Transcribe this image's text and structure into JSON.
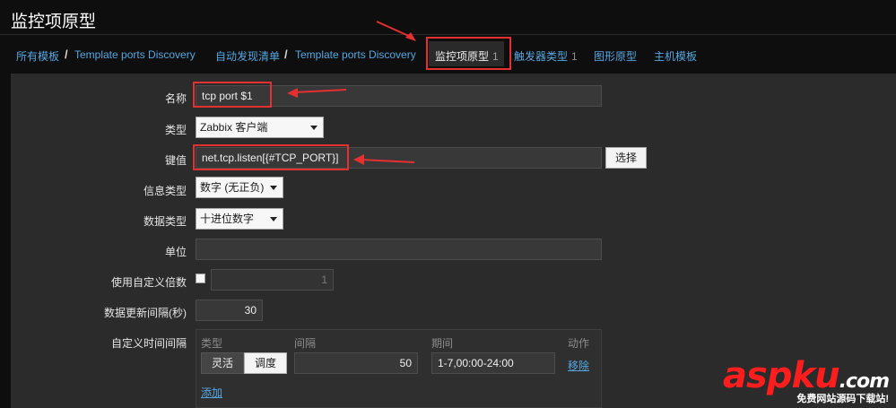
{
  "page": {
    "title": "监控项原型"
  },
  "breadcrumb": {
    "all_templates": "所有模板",
    "template1": "Template ports Discovery",
    "discovery_list": "自动发现清单",
    "template2": "Template ports Discovery",
    "separator": "/"
  },
  "tabs": [
    {
      "label": "监控项原型",
      "count": "1"
    },
    {
      "label": "触发器类型",
      "count": "1"
    },
    {
      "label": "图形原型",
      "count": ""
    },
    {
      "label": "主机模板",
      "count": ""
    }
  ],
  "form": {
    "name": {
      "label": "名称",
      "value": "tcp port $1"
    },
    "type": {
      "label": "类型",
      "value": "Zabbix 客户端"
    },
    "key": {
      "label": "键值",
      "value": "net.tcp.listen[{#TCP_PORT}]",
      "select_button": "选择"
    },
    "info_type": {
      "label": "信息类型",
      "value": "数字 (无正负)"
    },
    "data_type": {
      "label": "数据类型",
      "value": "十进位数字"
    },
    "units": {
      "label": "单位",
      "value": ""
    },
    "multiplier": {
      "label": "使用自定义倍数",
      "value": "1"
    },
    "update_interval": {
      "label": "数据更新间隔(秒)",
      "value": "30"
    },
    "custom_intervals": {
      "label": "自定义时间间隔",
      "headers": {
        "type": "类型",
        "interval": "间隔",
        "period": "期间",
        "action": "动作"
      },
      "row": {
        "flexible": "灵活",
        "scheduling": "调度",
        "interval": "50",
        "period": "1-7,00:00-24:00",
        "remove": "移除"
      },
      "add": "添加"
    }
  },
  "watermark": {
    "brand_red": "asp",
    "brand_dark": "ku",
    "suffix": ".com",
    "sub": "免费网站源码下载站!"
  },
  "colors": {
    "link": "#56a7e0",
    "annotation": "#e33131",
    "panel": "#2b2b2b"
  }
}
